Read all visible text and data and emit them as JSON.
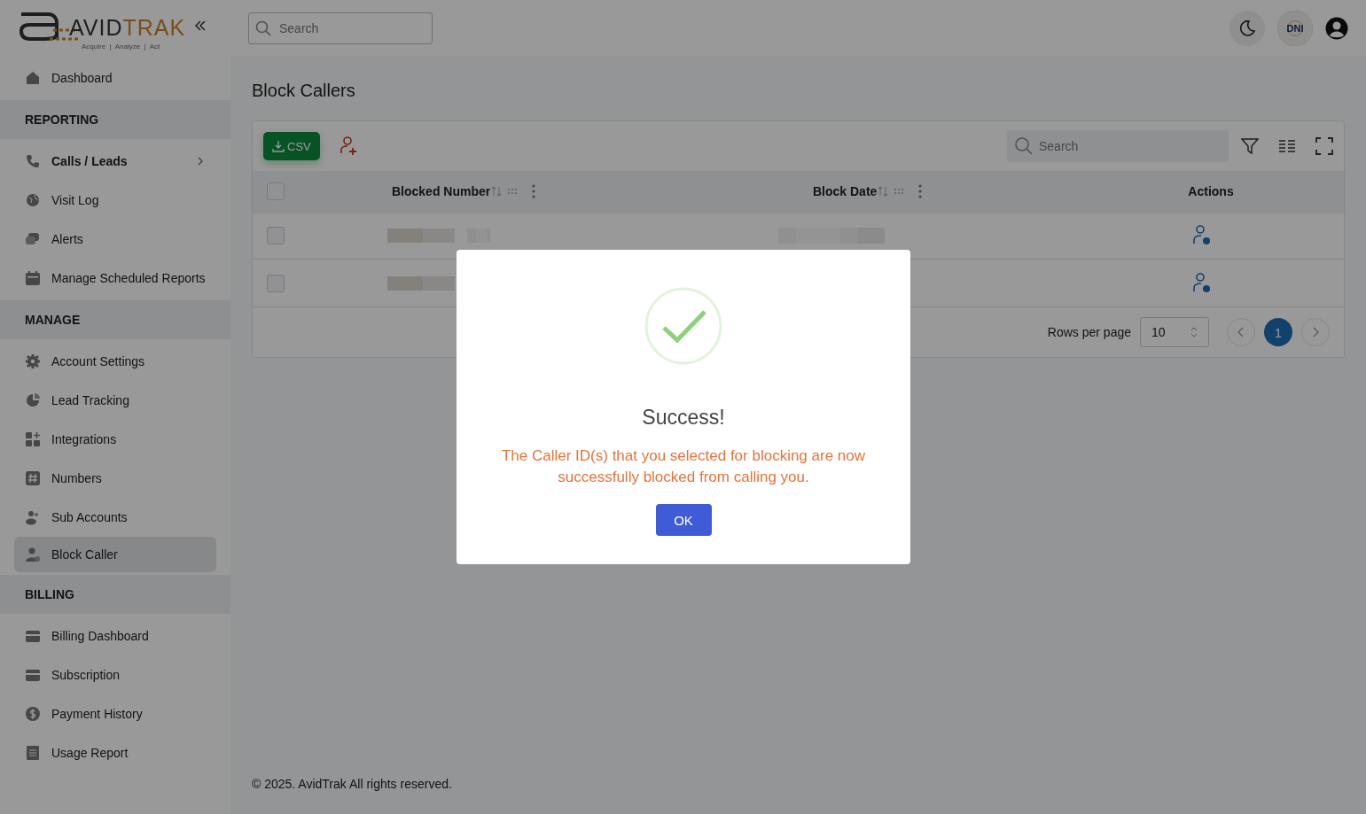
{
  "sidebar": {
    "logo": {
      "word_1": "AVID",
      "word_2": "TRAK",
      "tagline": "Acquire  |  Analyze  |  Act"
    },
    "groups": [
      {
        "items": [
          {
            "label": "Dashboard",
            "kind": "home",
            "submenu": false,
            "selected": false
          }
        ]
      },
      {
        "heading": "REPORTING",
        "items": [
          {
            "label": "Calls / Leads",
            "kind": "phone",
            "submenu": true,
            "selected": false
          },
          {
            "label": "Visit Log",
            "kind": "globe",
            "submenu": false,
            "selected": false
          },
          {
            "label": "Alerts",
            "kind": "chat",
            "submenu": false,
            "selected": false
          },
          {
            "label": "Manage Scheduled Reports",
            "kind": "calendar",
            "submenu": false,
            "selected": false
          }
        ]
      },
      {
        "heading": "MANAGE",
        "items": [
          {
            "label": "Account Settings",
            "kind": "gear",
            "submenu": false,
            "selected": false
          },
          {
            "label": "Lead Tracking",
            "kind": "pie",
            "submenu": false,
            "selected": false
          },
          {
            "label": "Integrations",
            "kind": "grid",
            "submenu": false,
            "selected": false
          },
          {
            "label": "Numbers",
            "kind": "hash",
            "submenu": false,
            "selected": false
          },
          {
            "label": "Sub Accounts",
            "kind": "users",
            "submenu": false,
            "selected": false
          },
          {
            "label": "Block Caller",
            "kind": "user",
            "submenu": false,
            "selected": true
          }
        ]
      },
      {
        "heading": "BILLING",
        "items": [
          {
            "label": "Billing Dashboard",
            "kind": "card",
            "submenu": false,
            "selected": false
          },
          {
            "label": "Subscription",
            "kind": "card",
            "submenu": false,
            "selected": false
          },
          {
            "label": "Payment History",
            "kind": "dollar",
            "submenu": false,
            "selected": false
          },
          {
            "label": "Usage Report",
            "kind": "doc",
            "submenu": false,
            "selected": false
          }
        ]
      }
    ]
  },
  "topbar": {
    "search": {
      "placeholder": "Search"
    },
    "badge": "DNI"
  },
  "page": {
    "title": "Block Callers",
    "toolbar": {
      "csv_button": "CSV",
      "search": {
        "placeholder": "Search"
      }
    },
    "table": {
      "header_checked": false,
      "columns": [
        {
          "label": "Blocked Number",
          "kind": "sortable"
        },
        {
          "label": "Block Date",
          "kind": "sortable"
        },
        {
          "label": "Actions",
          "kind": "plain"
        }
      ],
      "rows": [
        {
          "checked": false
        },
        {
          "checked": false
        }
      ]
    },
    "pagination": {
      "label": "Rows per page",
      "rows_per_page": "10",
      "pages": [
        {
          "label": "1",
          "selected": true
        }
      ]
    }
  },
  "footer": "© 2025. AvidTrak All rights reserved.",
  "dialog": {
    "title": "Success!",
    "message": "The Caller ID(s) that you selected for blocking are now successfully blocked from calling you.",
    "button": "OK"
  }
}
